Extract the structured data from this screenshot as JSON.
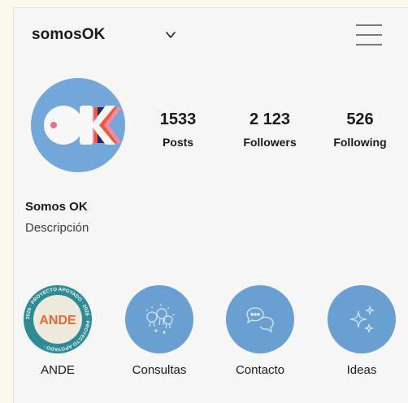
{
  "header": {
    "username": "somosOK"
  },
  "profile": {
    "display_name": "Somos OK",
    "description": "Descripción",
    "avatar_text": "OK"
  },
  "stats": [
    {
      "value": "1533",
      "label": "Posts"
    },
    {
      "value": "2 123",
      "label": "Followers"
    },
    {
      "value": "526",
      "label": "Following"
    }
  ],
  "highlights": [
    {
      "label": "ANDE",
      "badge_text": "ANDE",
      "ring_text": "2026 · PROYECTO APOYADO · 2026 · PROYECTO APOYADO ·",
      "icon": "ande-badge-icon"
    },
    {
      "label": "Consultas",
      "icon": "lightbulbs-icon"
    },
    {
      "label": "Contacto",
      "icon": "chat-bubbles-icon"
    },
    {
      "label": "Ideas",
      "icon": "sparkles-icon"
    }
  ],
  "colors": {
    "accent": "#6a9fd2",
    "avatar_bg": "#74a7d9",
    "ande_ring": "#2c8c96"
  }
}
